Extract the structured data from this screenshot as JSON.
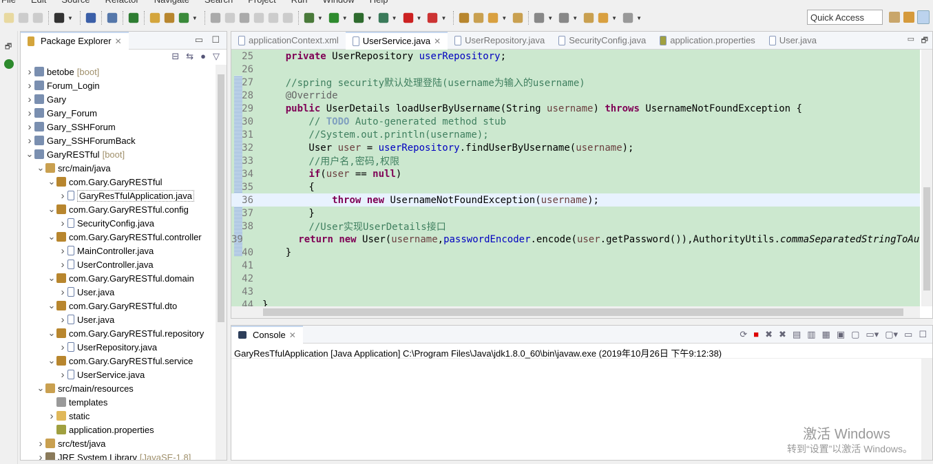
{
  "menu": [
    "File",
    "Edit",
    "Source",
    "Refactor",
    "Navigate",
    "Search",
    "Project",
    "Run",
    "Window",
    "Help"
  ],
  "quick_access": "Quick Access",
  "explorer": {
    "title": "Package Explorer",
    "items": [
      {
        "label": "betobe",
        "suffix": "[boot]",
        "level": 0,
        "open": false,
        "icon": "project"
      },
      {
        "label": "Forum_Login",
        "level": 0,
        "open": false,
        "icon": "project"
      },
      {
        "label": "Gary",
        "level": 0,
        "open": false,
        "icon": "project"
      },
      {
        "label": "Gary_Forum",
        "level": 0,
        "open": false,
        "icon": "project"
      },
      {
        "label": "Gary_SSHForum",
        "level": 0,
        "open": false,
        "icon": "project"
      },
      {
        "label": "Gary_SSHForumBack",
        "level": 0,
        "open": false,
        "icon": "project"
      },
      {
        "label": "GaryRESTful",
        "suffix": "[boot]",
        "level": 0,
        "open": true,
        "icon": "project"
      },
      {
        "label": "src/main/java",
        "level": 1,
        "open": true,
        "icon": "source-folder"
      },
      {
        "label": "com.Gary.GaryRESTful",
        "level": 2,
        "open": true,
        "icon": "package"
      },
      {
        "label": "GaryResTfulApplication.java",
        "level": 3,
        "open": false,
        "icon": "java-file",
        "selected": true
      },
      {
        "label": "com.Gary.GaryRESTful.config",
        "level": 2,
        "open": true,
        "icon": "package"
      },
      {
        "label": "SecurityConfig.java",
        "level": 3,
        "open": false,
        "icon": "java-file"
      },
      {
        "label": "com.Gary.GaryRESTful.controller",
        "level": 2,
        "open": true,
        "icon": "package"
      },
      {
        "label": "MainController.java",
        "level": 3,
        "open": false,
        "icon": "java-file"
      },
      {
        "label": "UserController.java",
        "level": 3,
        "open": false,
        "icon": "java-file"
      },
      {
        "label": "com.Gary.GaryRESTful.domain",
        "level": 2,
        "open": true,
        "icon": "package"
      },
      {
        "label": "User.java",
        "level": 3,
        "open": false,
        "icon": "java-file"
      },
      {
        "label": "com.Gary.GaryRESTful.dto",
        "level": 2,
        "open": true,
        "icon": "package"
      },
      {
        "label": "User.java",
        "level": 3,
        "open": false,
        "icon": "java-file"
      },
      {
        "label": "com.Gary.GaryRESTful.repository",
        "level": 2,
        "open": true,
        "icon": "package"
      },
      {
        "label": "UserRepository.java",
        "level": 3,
        "open": false,
        "icon": "java-file"
      },
      {
        "label": "com.Gary.GaryRESTful.service",
        "level": 2,
        "open": true,
        "icon": "package"
      },
      {
        "label": "UserService.java",
        "level": 3,
        "open": false,
        "icon": "java-file"
      },
      {
        "label": "src/main/resources",
        "level": 1,
        "open": true,
        "icon": "source-folder"
      },
      {
        "label": "templates",
        "level": 2,
        "leaf": true,
        "icon": "grid-folder"
      },
      {
        "label": "static",
        "level": 2,
        "open": false,
        "icon": "folder"
      },
      {
        "label": "application.properties",
        "level": 2,
        "leaf": true,
        "icon": "properties"
      },
      {
        "label": "src/test/java",
        "level": 1,
        "open": false,
        "icon": "source-folder"
      },
      {
        "label": "JRE System Library",
        "suffix": "[JavaSE-1.8]",
        "level": 1,
        "open": false,
        "icon": "library"
      }
    ]
  },
  "editor": {
    "tabs": [
      {
        "label": "applicationContext.xml",
        "icon": "xml-file"
      },
      {
        "label": "UserService.java",
        "icon": "java-file",
        "active": true
      },
      {
        "label": "UserRepository.java",
        "icon": "java-file"
      },
      {
        "label": "SecurityConfig.java",
        "icon": "java-file"
      },
      {
        "label": "application.properties",
        "icon": "properties"
      },
      {
        "label": "User.java",
        "icon": "java-file"
      }
    ],
    "current_line": "36",
    "lines": [
      {
        "n": "25",
        "t": [
          [
            "    "
          ],
          [
            "private",
            "kw"
          ],
          [
            " UserRepository "
          ],
          [
            "userRepository",
            "fd"
          ],
          [
            ";"
          ]
        ]
      },
      {
        "n": "26",
        "t": []
      },
      {
        "n": "27",
        "t": [
          [
            "    //spring security默认处理登陆(username为输入的username)",
            "cm"
          ]
        ]
      },
      {
        "n": "28",
        "t": [
          [
            "    "
          ],
          [
            "@Override",
            "an"
          ]
        ]
      },
      {
        "n": "29",
        "t": [
          [
            "    "
          ],
          [
            "public",
            "kw"
          ],
          [
            " UserDetails loadUserByUsername(String "
          ],
          [
            "username",
            "pr"
          ],
          [
            ") "
          ],
          [
            "throws",
            "kw"
          ],
          [
            " UsernameNotFoundException {"
          ]
        ]
      },
      {
        "n": "30",
        "t": [
          [
            "        // ",
            "cm"
          ],
          [
            "TODO",
            "todo"
          ],
          [
            " Auto-generated method stub",
            "cm"
          ]
        ]
      },
      {
        "n": "31",
        "t": [
          [
            "        //System.out.println(username);",
            "cm"
          ]
        ]
      },
      {
        "n": "32",
        "t": [
          [
            "        User "
          ],
          [
            "user",
            "pr"
          ],
          [
            " = "
          ],
          [
            "userRepository",
            "fd"
          ],
          [
            ".findUserByUsername("
          ],
          [
            "username",
            "pr"
          ],
          [
            ");"
          ]
        ]
      },
      {
        "n": "33",
        "t": [
          [
            "        //用户名,密码,权限",
            "cm"
          ]
        ]
      },
      {
        "n": "34",
        "t": [
          [
            "        "
          ],
          [
            "if",
            "kw"
          ],
          [
            "("
          ],
          [
            "user",
            "pr"
          ],
          [
            " == "
          ],
          [
            "null",
            "kw"
          ],
          [
            ")"
          ]
        ]
      },
      {
        "n": "35",
        "t": [
          [
            "        {"
          ]
        ]
      },
      {
        "n": "36",
        "t": [
          [
            "            "
          ],
          [
            "throw",
            "kw"
          ],
          [
            " "
          ],
          [
            "new",
            "kw"
          ],
          [
            " UsernameNotFoundException("
          ],
          [
            "username",
            "pr"
          ],
          [
            ");"
          ]
        ]
      },
      {
        "n": "37",
        "t": [
          [
            "        }"
          ]
        ]
      },
      {
        "n": "38",
        "t": [
          [
            "        //User实现UserDetails接口",
            "cm"
          ]
        ]
      },
      {
        "n": "39",
        "t": [
          [
            "        "
          ],
          [
            "return",
            "kw"
          ],
          [
            " "
          ],
          [
            "new",
            "kw"
          ],
          [
            " User("
          ],
          [
            "username",
            "pr"
          ],
          [
            ","
          ],
          [
            "passwordEncoder",
            "fd"
          ],
          [
            ".encode("
          ],
          [
            "user",
            "pr"
          ],
          [
            ".getPassword()),AuthorityUtils."
          ],
          [
            "commaSeparatedStringToAuthorityList(\"admin\"));",
            "it"
          ]
        ]
      },
      {
        "n": "40",
        "t": [
          [
            "    }"
          ]
        ]
      },
      {
        "n": "41",
        "t": []
      },
      {
        "n": "42",
        "t": []
      },
      {
        "n": "43",
        "t": []
      },
      {
        "n": "44",
        "t": [
          [
            "}"
          ]
        ]
      }
    ]
  },
  "console": {
    "title": "Console",
    "description": "GaryResTfulApplication [Java Application] C:\\Program Files\\Java\\jdk1.8.0_60\\bin\\javaw.exe (2019年10月26日 下午9:12:38)"
  },
  "watermark": {
    "line1": "激活 Windows",
    "line2": "转到“设置”以激活 Windows。"
  },
  "colors": {
    "editor_bg": "#cce8cf",
    "current_line": "#e8f2fe",
    "keyword": "#7f0055",
    "comment": "#3f7f5f",
    "field": "#0000c0"
  }
}
